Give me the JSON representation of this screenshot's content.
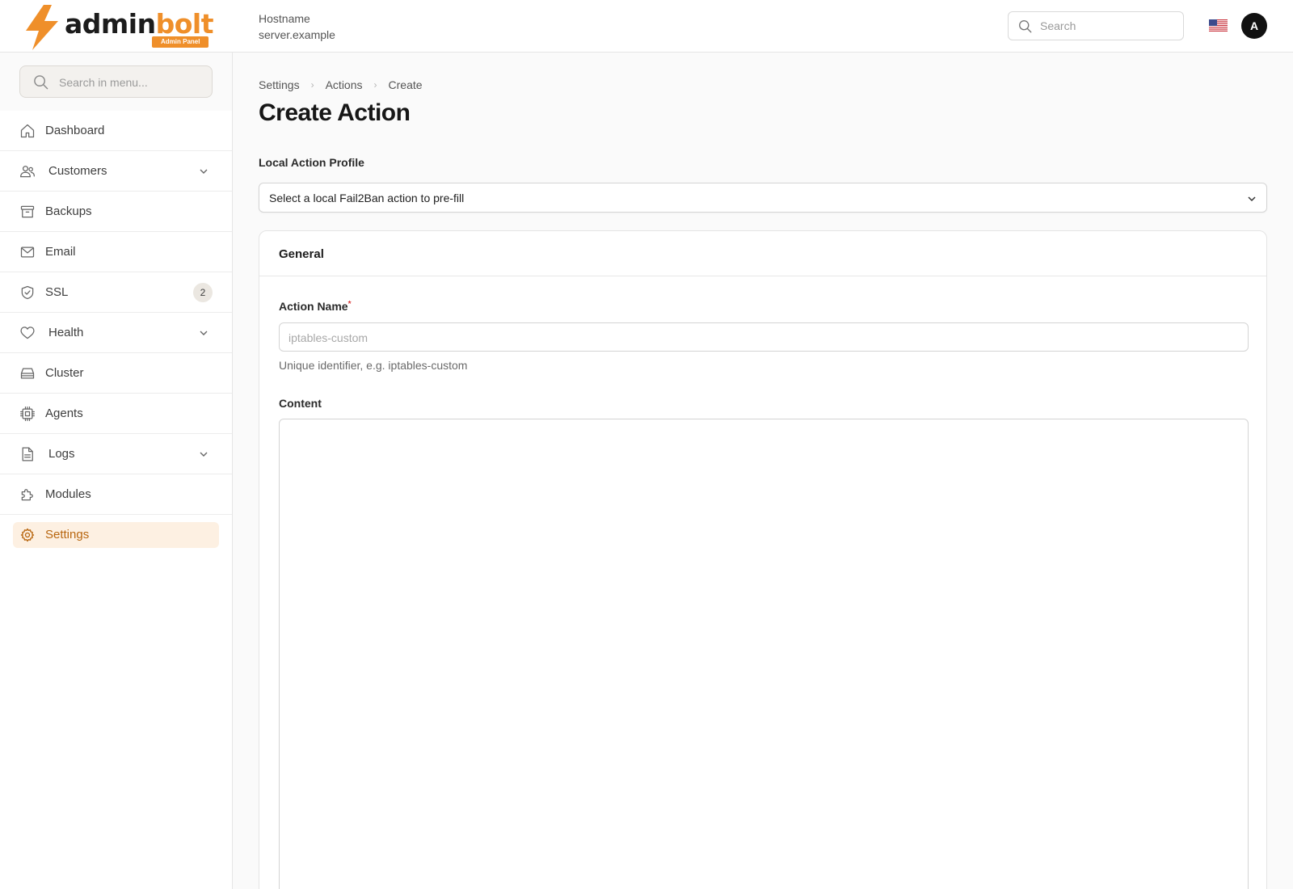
{
  "brand": {
    "name_part1": "admin",
    "name_part2": "bolt",
    "badge": "Admin Panel",
    "accent_color": "#ef8f2a"
  },
  "header": {
    "host_label": "Hostname",
    "host_value": "server.example",
    "search_placeholder": "Search",
    "search_icon": "search-icon",
    "locale_icon": "us-flag-icon",
    "avatar_initial": "A"
  },
  "sidebar": {
    "search_placeholder": "Search in menu...",
    "items": [
      {
        "label": "Dashboard",
        "icon": "home-icon"
      },
      {
        "label": "Customers",
        "icon": "users-icon",
        "expandable": true
      },
      {
        "label": "Backups",
        "icon": "archive-icon"
      },
      {
        "label": "Email",
        "icon": "mail-icon"
      },
      {
        "label": "SSL",
        "icon": "shield-check-icon",
        "badge": "2"
      },
      {
        "label": "Health",
        "icon": "heart-icon",
        "expandable": true
      },
      {
        "label": "Cluster",
        "icon": "server-icon"
      },
      {
        "label": "Agents",
        "icon": "cpu-icon"
      },
      {
        "label": "Logs",
        "icon": "file-text-icon",
        "expandable": true
      },
      {
        "label": "Modules",
        "icon": "puzzle-icon"
      },
      {
        "label": "Settings",
        "icon": "gear-icon",
        "active": true
      }
    ]
  },
  "breadcrumb": [
    "Settings",
    "Actions",
    "Create"
  ],
  "page_title": "Create Action",
  "profile": {
    "label": "Local Action Profile",
    "value": "Select a local Fail2Ban action to pre-fill"
  },
  "section": {
    "title": "General",
    "action_name_label": "Action Name",
    "required_mark": "*",
    "action_name_placeholder": "iptables-custom",
    "action_name_help": "Unique identifier, e.g. iptables-custom",
    "content_label": "Content"
  }
}
